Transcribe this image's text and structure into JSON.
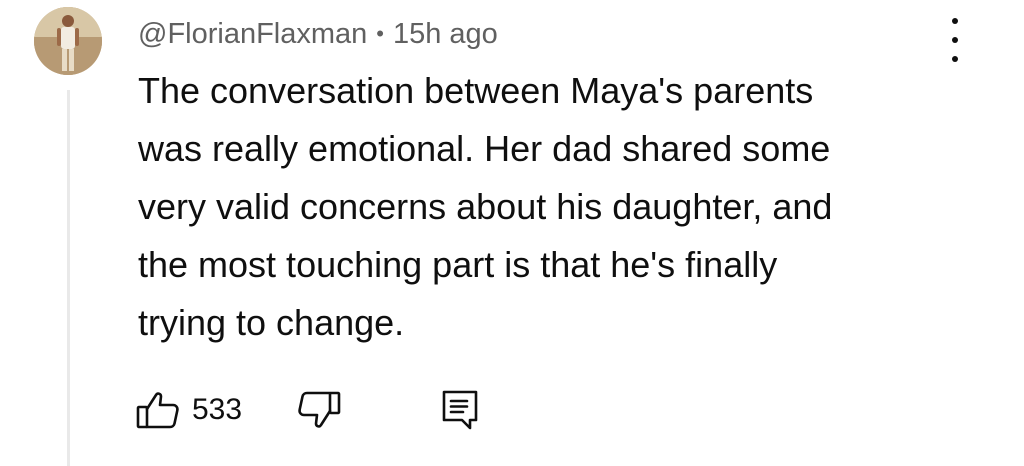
{
  "comment": {
    "author": "@FlorianFlaxman",
    "separator": "•",
    "timestamp": "15h ago",
    "text_lines": [
      "The conversation between Maya's parents",
      "was really emotional. Her dad shared some",
      "very valid concerns about his daughter, and",
      "the most touching part is that he's finally",
      "trying to change."
    ],
    "like_count": "533"
  },
  "icons": {
    "menu": "more-vertical-icon",
    "like": "thumb-up-icon",
    "dislike": "thumb-down-icon",
    "reply": "comment-reply-icon"
  },
  "colors": {
    "text": "#0f0f0f",
    "meta_text": "#606060",
    "thread_line": "#e9e9e9"
  }
}
